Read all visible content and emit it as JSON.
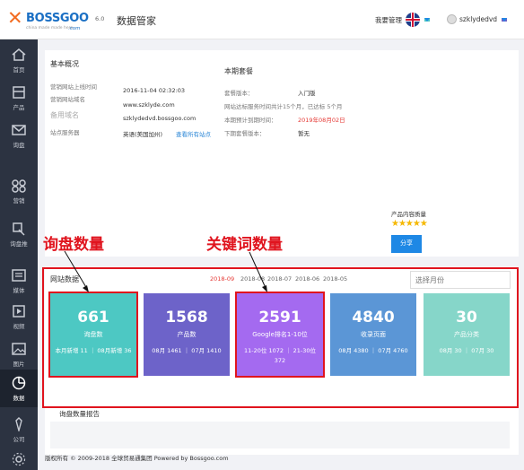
{
  "header": {
    "logo_brand": "BOSSGOO",
    "logo_suffix": ".com",
    "logo_tagline": "china made made here",
    "version": "6.0",
    "app_title": "数据管家",
    "manage_link": "我要管理",
    "username": "szklydedvd"
  },
  "sidebar": {
    "items": [
      {
        "label": "首页",
        "icon": "home-icon"
      },
      {
        "label": "产品",
        "icon": "product-icon"
      },
      {
        "label": "询盘",
        "icon": "inquiry-icon"
      },
      {
        "label": "营销",
        "icon": "marketing-icon"
      },
      {
        "label": "询盘推",
        "icon": "inquiry-push-icon"
      },
      {
        "label": "媒体",
        "icon": "media-icon"
      },
      {
        "label": "视频",
        "icon": "video-icon"
      },
      {
        "label": "图片",
        "icon": "image-icon"
      },
      {
        "label": "数据",
        "icon": "data-icon"
      },
      {
        "label": "公司",
        "icon": "company-icon"
      },
      {
        "label": "设置",
        "icon": "settings-icon"
      }
    ],
    "active": "数据"
  },
  "overview": {
    "title": "基本概况",
    "site_online_label": "营销网站上线时间",
    "site_online_value": "2016-11-04 02:32:03",
    "domain_label": "营销网站域名",
    "domain_value1": "www.szklyde.com",
    "domain_value2": "szklydedvd.bossgoo.com",
    "alias_label": "备用域名",
    "server_label": "站点服务器",
    "server_value": "英语(美国加州)",
    "server_link": "查看所有站点"
  },
  "plan": {
    "title": "本期套餐",
    "version_label": "套餐版本：",
    "version_value": "入门版",
    "service_label": "网站达标服务时间共计15个月，已达标 5个月",
    "expire_label": "本期预计到期时间：",
    "expire_value": "2019年08月02日",
    "next_label": "下期套餐版本：",
    "next_value": "暂无"
  },
  "quality": {
    "label": "产品内容质量",
    "stars": "★★★★★",
    "share_label": "分享"
  },
  "website_data": {
    "title": "网站数据",
    "months": [
      "2018-09",
      "2018-08",
      "2018-07",
      "2018-06",
      "2018-05"
    ],
    "active_month": "2018-09",
    "month_placeholder": "选择月份",
    "cards": [
      {
        "value": "661",
        "name": "询盘数",
        "sub": "本月新增 11 ｜ 08月新增 36"
      },
      {
        "value": "1568",
        "name": "产品数",
        "sub": "08月 1461 ｜ 07月 1410"
      },
      {
        "value": "2591",
        "name": "Google排名1-10位",
        "sub": "11-20位 1072 ｜ 21-30位 372"
      },
      {
        "value": "4840",
        "name": "收录页面",
        "sub": "08月 4380 ｜ 07月 4760"
      },
      {
        "value": "30",
        "name": "产品分类",
        "sub": "08月 30 ｜ 07月 30"
      }
    ],
    "report_title": "询盘数量报告"
  },
  "annotations": {
    "inquiry_label": "询盘数量",
    "keyword_label": "关键词数量"
  },
  "footer": {
    "copyright": "版权所有 © 2009-2018 全球贸易通集团 Powered by Bossgoo.com"
  },
  "colors": {
    "accent": "#1e88e5",
    "annotation": "#e0141e",
    "card_inquiry": "#4dc8c3",
    "card_products": "#6d63c9",
    "card_google": "#a46af0",
    "card_pages": "#5b96d6",
    "card_category": "#71d0c0"
  }
}
